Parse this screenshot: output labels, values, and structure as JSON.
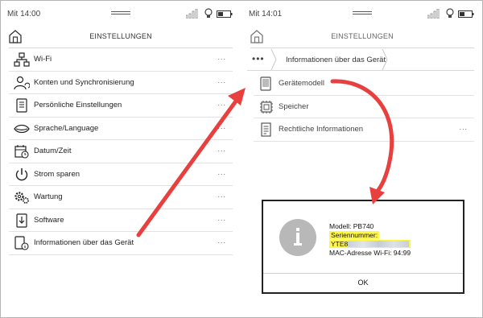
{
  "left_screen": {
    "status": {
      "time": "Mit 14:00"
    },
    "header": {
      "title": "EINSTELLUNGEN"
    },
    "menu": [
      {
        "label": "Wi-Fi",
        "icon": "wifi-network-icon",
        "dots": "..."
      },
      {
        "label": "Konten und Synchronisierung",
        "icon": "account-sync-icon",
        "dots": "..."
      },
      {
        "label": "Persönliche Einstellungen",
        "icon": "personal-settings-icon",
        "dots": "..."
      },
      {
        "label": "Sprache/Language",
        "icon": "language-lips-icon",
        "dots": "..."
      },
      {
        "label": "Datum/Zeit",
        "icon": "calendar-clock-icon",
        "dots": "..."
      },
      {
        "label": "Strom sparen",
        "icon": "power-icon",
        "dots": "..."
      },
      {
        "label": "Wartung",
        "icon": "maintenance-gear-icon",
        "dots": "..."
      },
      {
        "label": "Software",
        "icon": "software-download-icon",
        "dots": "..."
      },
      {
        "label": "Informationen über das Gerät",
        "icon": "device-info-icon",
        "dots": "..."
      }
    ]
  },
  "right_screen": {
    "status": {
      "time": "Mit 14:01"
    },
    "header": {
      "title": "EINSTELLUNGEN"
    },
    "breadcrumb": {
      "more": "•••",
      "current": "Informationen über das Gerät"
    },
    "menu": [
      {
        "label": "Gerätemodell",
        "icon": "device-model-icon",
        "dots": ""
      },
      {
        "label": "Speicher",
        "icon": "memory-chip-icon",
        "dots": ""
      },
      {
        "label": "Rechtliche Informationen",
        "icon": "legal-document-icon",
        "dots": "..."
      }
    ],
    "dialog": {
      "model_line": "Modell: PB740",
      "serial_label": "Seriennummer:",
      "serial_prefix": "YTE8",
      "mac_line": "MAC-Adresse Wi-Fi: 94:99",
      "ok_label": "OK"
    }
  },
  "colors": {
    "arrow": "#e8403f",
    "highlight": "#fff64a",
    "info_circle": "#b8b8b8"
  }
}
